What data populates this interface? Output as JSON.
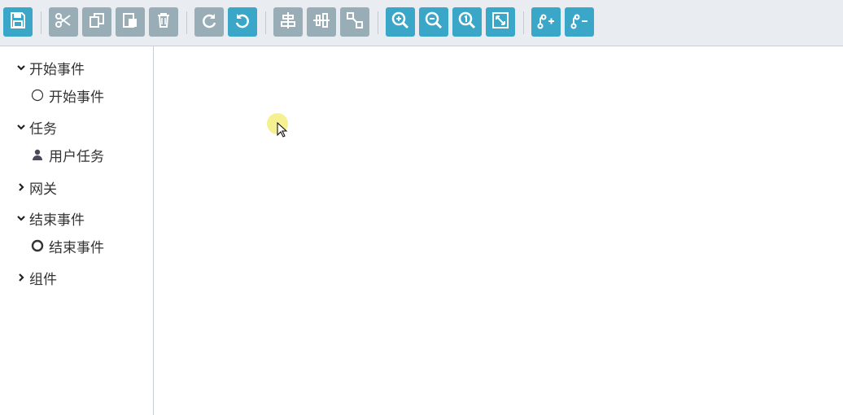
{
  "toolbar": {
    "accent_color": "#3aa7c9",
    "disabled_color": "#98adb6",
    "buttons": [
      {
        "icon": "save-icon",
        "state": "active"
      },
      {
        "icon": "cut-icon",
        "state": "disabled"
      },
      {
        "icon": "copy-icon",
        "state": "disabled"
      },
      {
        "icon": "paste-icon",
        "state": "disabled"
      },
      {
        "icon": "delete-icon",
        "state": "disabled"
      },
      {
        "icon": "redo-icon",
        "state": "disabled"
      },
      {
        "icon": "undo-icon",
        "state": "active"
      },
      {
        "icon": "align-horizontal-icon",
        "state": "disabled"
      },
      {
        "icon": "align-vertical-icon",
        "state": "disabled"
      },
      {
        "icon": "same-size-icon",
        "state": "disabled"
      },
      {
        "icon": "zoom-in-icon",
        "state": "active"
      },
      {
        "icon": "zoom-out-icon",
        "state": "active"
      },
      {
        "icon": "zoom-actual-icon",
        "state": "active"
      },
      {
        "icon": "zoom-fit-icon",
        "state": "active"
      },
      {
        "icon": "add-bendpoint-icon",
        "state": "active"
      },
      {
        "icon": "remove-bendpoint-icon",
        "state": "active"
      }
    ]
  },
  "sidebar": {
    "groups": [
      {
        "label": "开始事件",
        "expanded": true,
        "items": [
          {
            "label": "开始事件",
            "icon": "start-event-circle-icon"
          }
        ]
      },
      {
        "label": "任务",
        "expanded": true,
        "items": [
          {
            "label": "用户任务",
            "icon": "user-icon"
          }
        ]
      },
      {
        "label": "网关",
        "expanded": false,
        "items": []
      },
      {
        "label": "结束事件",
        "expanded": true,
        "items": [
          {
            "label": "结束事件",
            "icon": "end-event-circle-icon"
          }
        ]
      },
      {
        "label": "组件",
        "expanded": false,
        "items": []
      }
    ]
  }
}
